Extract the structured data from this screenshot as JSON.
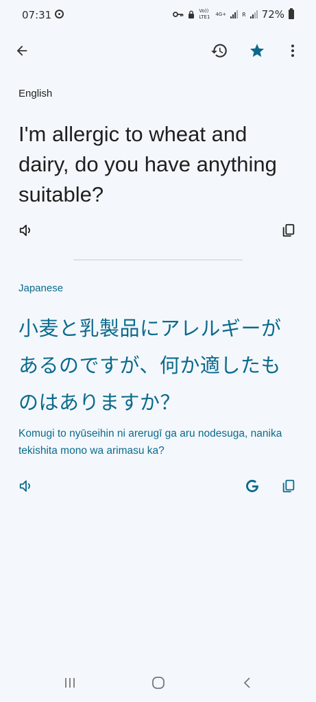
{
  "status_bar": {
    "time": "07:31",
    "net_volte": "Vo)) LTE1",
    "net_4g": "4G+",
    "net_r": "R",
    "battery": "72%"
  },
  "toolbar": {
    "back_icon": "arrow-back",
    "history_icon": "history",
    "star_icon": "star-filled",
    "more_icon": "more-vert"
  },
  "source": {
    "language": "English",
    "text": "I'm allergic to wheat and dairy, do you have anything suitable?"
  },
  "target": {
    "language": "Japanese",
    "text": "小麦と乳製品にアレルギーがあるのですが、何か適したものはありますか？",
    "transliteration": "Komugi to nyūseihin ni arerugī ga aru nodesuga, nanika tekishita mono wa arimasu ka?"
  },
  "colors": {
    "accent": "#0b6a8c",
    "background": "#f4f8fc",
    "text": "#1f1f1f"
  }
}
